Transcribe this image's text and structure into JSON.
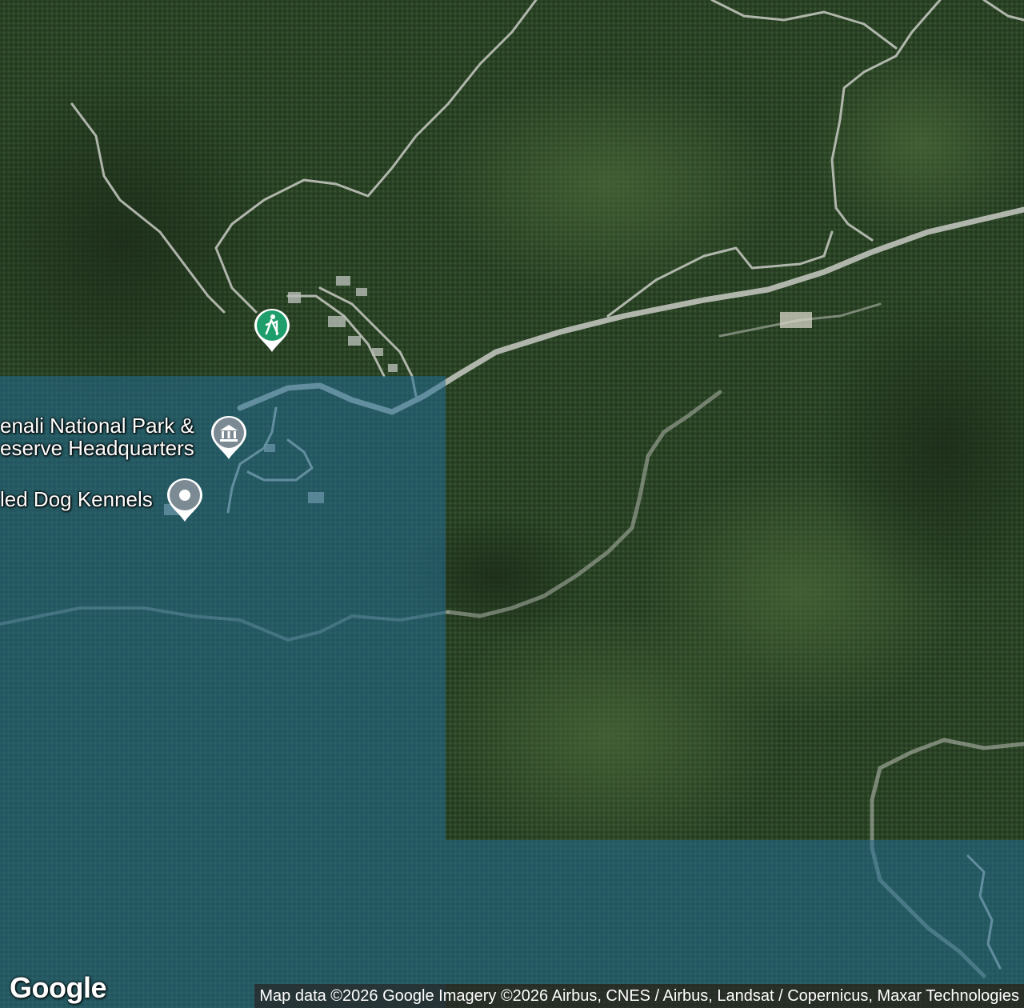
{
  "map": {
    "type": "satellite",
    "attribution": "Map data ©2026 Google Imagery ©2026 Airbus, CNES / Airbus, Landsat / Copernicus, Maxar Technologies",
    "logo": "Google",
    "colors": {
      "forest": "#2c4527",
      "road": "#c9ccc4",
      "overlay": "#236e96",
      "hiking_pin": "#1e9e6b",
      "museum_pin": "#7c8a94",
      "generic_pin": "#7c8a94"
    }
  },
  "pois": [
    {
      "id": "hiking",
      "icon": "hiker-icon",
      "label": ""
    },
    {
      "id": "hq",
      "icon": "museum-icon",
      "label_line1": "enali National Park &",
      "label_line2": "eserve Headquarters"
    },
    {
      "id": "kennels",
      "icon": "location-dot-icon",
      "label": "led Dog Kennels"
    }
  ]
}
